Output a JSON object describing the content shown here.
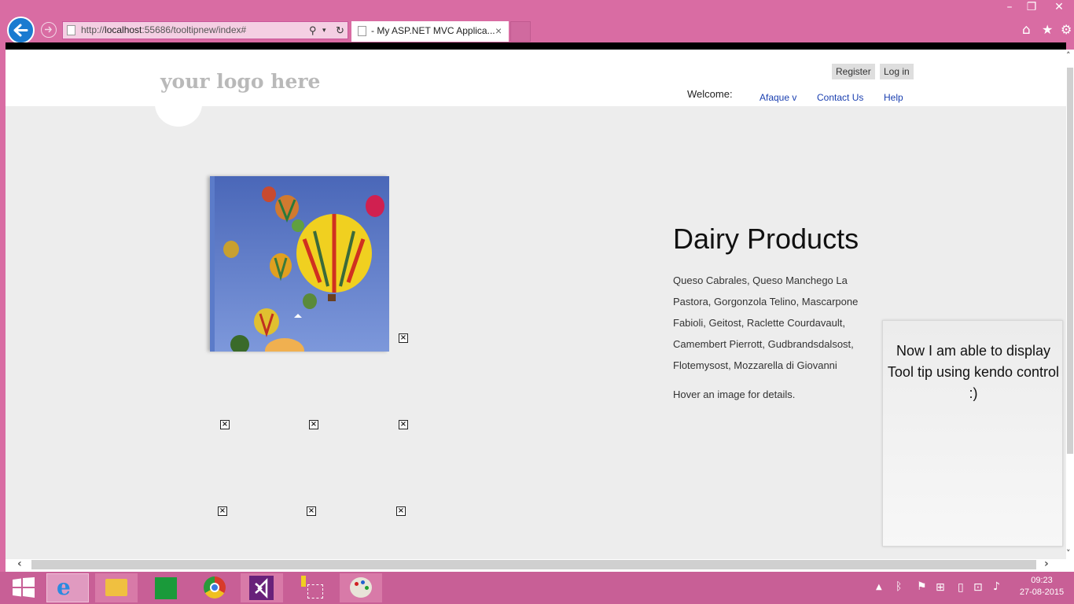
{
  "browser": {
    "url_host": "localhost",
    "url_prefix": "http://",
    "url_rest": ":55686/tooltipnew/index#",
    "tab_title": "- My ASP.NET MVC Applica...",
    "tab_close": "×"
  },
  "site": {
    "logo": "your logo here",
    "register": "Register",
    "login": "Log in",
    "welcome": "Welcome:",
    "nav": {
      "user": "Afaque v",
      "contact": "Contact Us",
      "help": "Help"
    }
  },
  "content": {
    "heading": "Dairy Products",
    "description": "Queso Cabrales, Queso Manchego La Pastora, Gorgonzola Telino, Mascarpone Fabioli, Geitost, Raclette Courdavault, Camembert Pierrott, Gudbrandsdalsost, Flotemysost, Mozzarella di Giovanni",
    "hint": "Hover an image for details."
  },
  "tooltip": {
    "text": "Now I am able to display Tool tip using kendo control :)"
  },
  "taskbar": {
    "time": "09:23",
    "date": "27-08-2015"
  },
  "colors": {
    "accent": "#d96ca3",
    "link": "#1a3fb0"
  }
}
